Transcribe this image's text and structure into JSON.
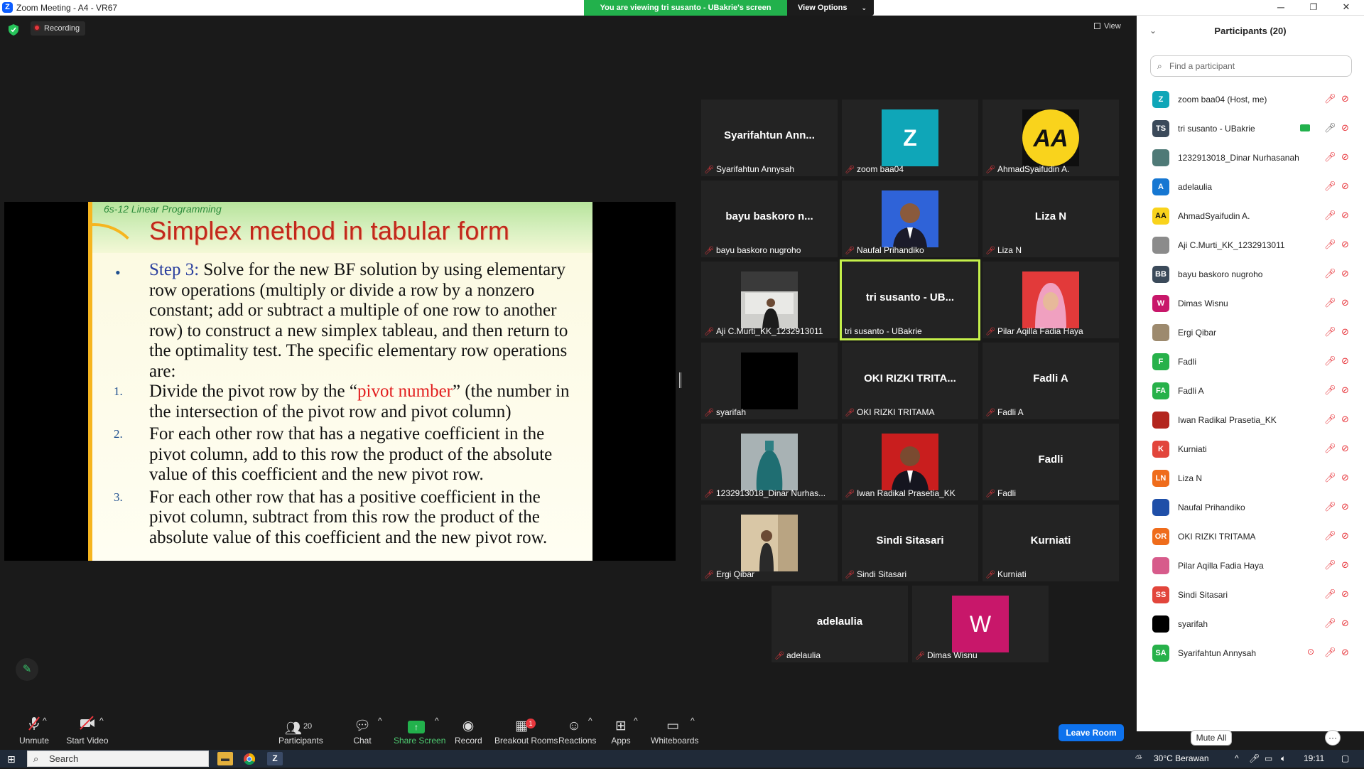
{
  "window": {
    "title": "Zoom Meeting - A4 - VR67",
    "viewing_banner": "You are viewing tri susanto - UBakrie's screen",
    "view_options": "View Options",
    "minimize": "─",
    "maximize": "❐",
    "close": "✕"
  },
  "meeting": {
    "recording_label": "Recording",
    "view_label": "View"
  },
  "slide": {
    "course": "6s-12   Linear Programming",
    "title": "Simplex method in tabular form",
    "step_label": "Step 3:",
    "step_text": " Solve for the new BF solution by using elementary row operations (multiply or divide a row by a nonzero constant; add or subtract a multiple of one row to another row) to construct a new simplex tableau, and then return to the optimality test. The specific elementary row operations are:",
    "bullet": "•",
    "items": [
      {
        "marker": "1.",
        "pre": "Divide the pivot row by the “",
        "highlight": "pivot number",
        "post": "” (the number in the intersection of the pivot row and pivot column)"
      },
      {
        "marker": "2.",
        "pre": "For each other row that has a negative coefficient in the pivot column, add to this row the product of the absolute value of this coefficient and the new pivot row.",
        "highlight": "",
        "post": ""
      },
      {
        "marker": "3.",
        "pre": "For each other row that has a positive coefficient in the pivot column, subtract from this row the product of the absolute value of this coefficient and the new pivot row.",
        "highlight": "",
        "post": ""
      }
    ]
  },
  "tiles": [
    {
      "big": "Syarifahtun  Ann...",
      "caption": "Syarifahtun Annysah"
    },
    {
      "big": "Z",
      "caption": "zoom baa04",
      "avatar_color": "#0fa6b8"
    },
    {
      "big": "AA",
      "caption": "AhmadSyaifudin A."
    },
    {
      "big": "bayu baskoro  n...",
      "caption": "bayu baskoro nugroho"
    },
    {
      "big": "",
      "caption": "Naufal Prihandiko"
    },
    {
      "big": "Liza N",
      "caption": "Liza N"
    },
    {
      "big": "",
      "caption": "Aji C.Murti_KK_1232913011"
    },
    {
      "big": "tri susanto - UB...",
      "caption": "tri susanto - UBakrie"
    },
    {
      "big": "",
      "caption": "Pilar Aqilla Fadia Haya"
    },
    {
      "big": "",
      "caption": "syarifah"
    },
    {
      "big": "OKI RIZKI TRITA...",
      "caption": "OKI RIZKI TRITAMA"
    },
    {
      "big": "Fadli A",
      "caption": "Fadli A"
    },
    {
      "big": "",
      "caption": "1232913018_Dinar Nurhas..."
    },
    {
      "big": "",
      "caption": "Iwan Radikal Prasetia_KK"
    },
    {
      "big": "Fadli",
      "caption": "Fadli"
    },
    {
      "big": "",
      "caption": "Ergi Qibar"
    },
    {
      "big": "Sindi Sitasari",
      "caption": "Sindi Sitasari"
    },
    {
      "big": "Kurniati",
      "caption": "Kurniati"
    },
    {
      "big": "adelaulia",
      "caption": "adelaulia"
    },
    {
      "big": "W",
      "caption": "Dimas Wisnu",
      "avatar_color": "#c8176a"
    }
  ],
  "panel": {
    "title": "Participants (20)",
    "search_placeholder": "Find a participant",
    "mute_all": "Mute All",
    "more": "···",
    "participants": [
      {
        "initials": "Z",
        "name": "zoom baa04 (Host, me)",
        "color": "#0fa6b8"
      },
      {
        "initials": "TS",
        "name": "tri susanto - UBakrie",
        "color": "#3b4a5a"
      },
      {
        "initials": "",
        "name": "1232913018_Dinar Nurhasanah",
        "color": "#4f7a77"
      },
      {
        "initials": "A",
        "name": "adelaulia",
        "color": "#1677d2"
      },
      {
        "initials": "AA",
        "name": "AhmadSyaifudin A.",
        "color": "#f9d31c"
      },
      {
        "initials": "",
        "name": "Aji C.Murti_KK_1232913011",
        "color": "#8b8b8b"
      },
      {
        "initials": "BB",
        "name": "bayu baskoro nugroho",
        "color": "#3b4a5a"
      },
      {
        "initials": "W",
        "name": "Dimas Wisnu",
        "color": "#c8176a"
      },
      {
        "initials": "",
        "name": "Ergi Qibar",
        "color": "#9d8a6e"
      },
      {
        "initials": "F",
        "name": "Fadli",
        "color": "#27b14a"
      },
      {
        "initials": "FA",
        "name": "Fadli A",
        "color": "#27b14a"
      },
      {
        "initials": "",
        "name": "Iwan Radikal Prasetia_KK",
        "color": "#b3261e"
      },
      {
        "initials": "K",
        "name": "Kurniati",
        "color": "#e2453b"
      },
      {
        "initials": "LN",
        "name": "Liza N",
        "color": "#ef6c1b"
      },
      {
        "initials": "",
        "name": "Naufal Prihandiko",
        "color": "#1f4fa8"
      },
      {
        "initials": "OR",
        "name": "OKI RIZKI TRITAMA",
        "color": "#ef6c1b"
      },
      {
        "initials": "",
        "name": "Pilar Aqilla Fadia Haya",
        "color": "#d75b8b"
      },
      {
        "initials": "SS",
        "name": "Sindi Sitasari",
        "color": "#e2453b"
      },
      {
        "initials": "",
        "name": "syarifah",
        "color": "#000000"
      },
      {
        "initials": "SA",
        "name": "Syarifahtun Annysah",
        "color": "#27b14a"
      }
    ]
  },
  "toolbar": {
    "unmute": "Unmute",
    "start_video": "Start Video",
    "participants": "Participants",
    "participants_count": "20",
    "chat": "Chat",
    "share_screen": "Share Screen",
    "record": "Record",
    "breakout_rooms": "Breakout Rooms",
    "breakout_badge": "1",
    "reactions": "Reactions",
    "apps": "Apps",
    "whiteboards": "Whiteboards",
    "leave_room": "Leave Room"
  },
  "taskbar": {
    "search": "Search",
    "weather": "30°C  Berawan",
    "time": "19:11"
  }
}
